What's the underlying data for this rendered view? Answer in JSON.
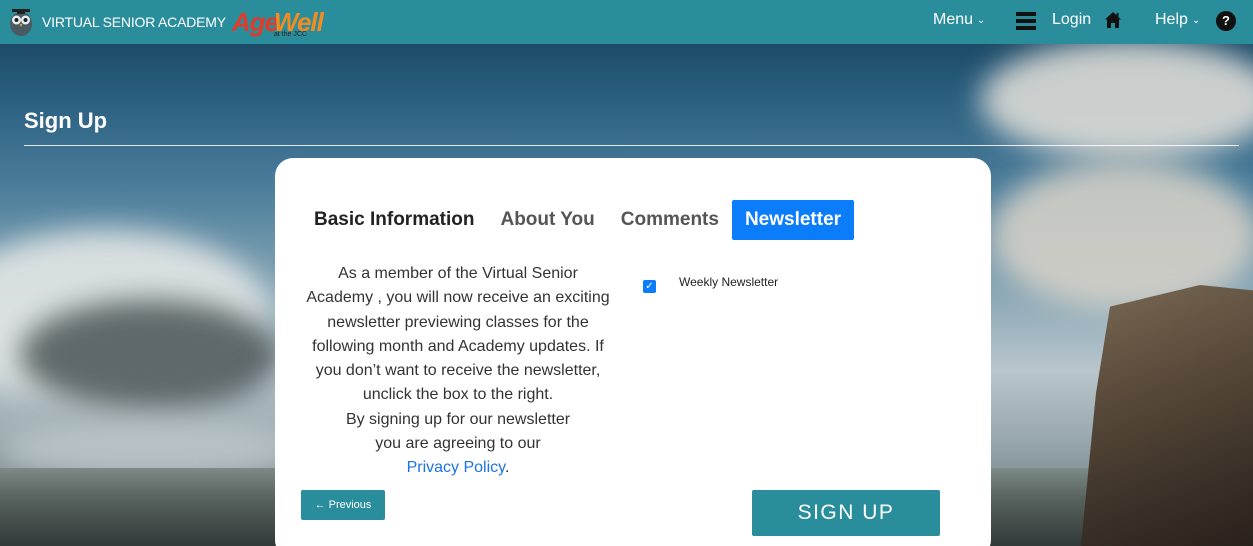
{
  "header": {
    "brand_text": "VIRTUAL SENIOR ACADEMY",
    "logo_age": "Age",
    "logo_well": "Well",
    "logo_sub": "at the JCC",
    "menu_label": "Menu",
    "login_label": "Login",
    "help_label": "Help",
    "help_icon_text": "?"
  },
  "page": {
    "title": "Sign Up"
  },
  "tabs": [
    {
      "label": "Basic Information"
    },
    {
      "label": "About You"
    },
    {
      "label": "Comments"
    },
    {
      "label": "Newsletter",
      "active": true
    }
  ],
  "newsletter": {
    "description_lines": [
      "As a member of the Virtual Senior",
      "Academy , you will now receive an exciting",
      "newsletter previewing classes for the",
      "following month and Academy updates. If",
      "you don’t want to receive the newsletter,",
      "unclick the box to the right.",
      "By signing up for our newsletter",
      "you are agreeing to our"
    ],
    "privacy_link": "Privacy Policy",
    "privacy_suffix": ".",
    "checkbox_label": "Weekly Newsletter",
    "checkbox_checked": true
  },
  "buttons": {
    "previous": "← Previous",
    "signup": "SIGN UP"
  },
  "colors": {
    "topbar": "#2a8d9c",
    "active_tab": "#0b7dfb",
    "link": "#1a73e8"
  }
}
